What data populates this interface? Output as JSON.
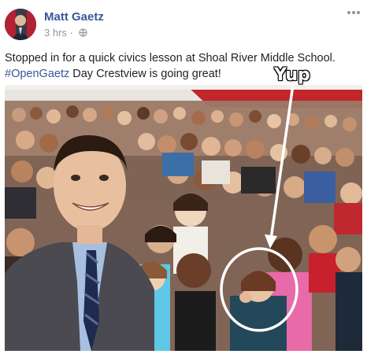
{
  "post": {
    "author_name": "Matt Gaetz",
    "timestamp": "3 hrs",
    "separator": "·",
    "privacy_icon": "globe-icon",
    "more_icon": "ellipsis-icon",
    "text_line1": "Stopped in for a quick civics lesson at Shoal River Middle School.",
    "hashtag": "#OpenGaetz",
    "text_line2_rest": " Day Crestview is going great!"
  },
  "photo": {
    "annotation_text": "Yup",
    "annotation_color": "#ffffff"
  },
  "colors": {
    "link": "#365899",
    "meta": "#90949c",
    "banner_red": "#c0262c"
  }
}
